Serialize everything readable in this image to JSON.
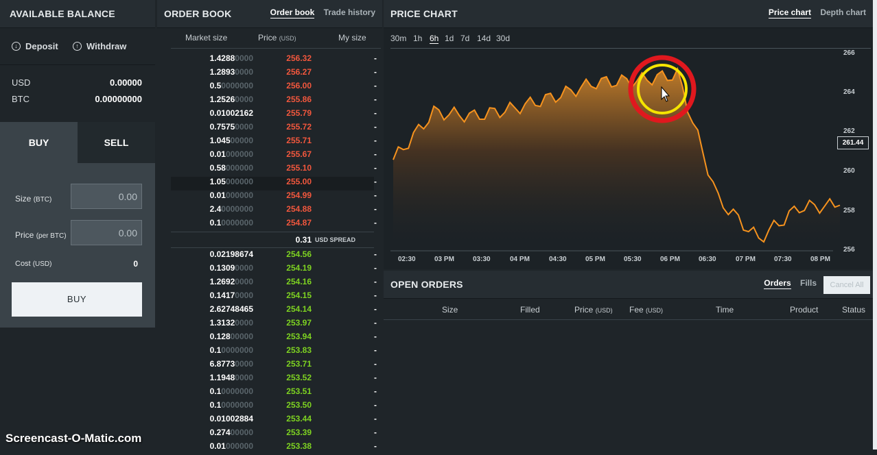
{
  "balance": {
    "title": "AVAILABLE BALANCE",
    "deposit": "Deposit",
    "withdraw": "Withdraw",
    "rows": [
      {
        "cur": "USD",
        "val": "0.00000"
      },
      {
        "cur": "BTC",
        "val": "0.00000000"
      }
    ]
  },
  "trade": {
    "buy_tab": "BUY",
    "sell_tab": "SELL",
    "size_label": "Size",
    "size_unit": "(BTC)",
    "size_value": "0.00",
    "price_label": "Price",
    "price_unit": "(per BTC)",
    "price_value": "0.00",
    "cost_label": "Cost",
    "cost_unit": "(USD)",
    "cost_value": "0",
    "buy_button": "BUY"
  },
  "book": {
    "title": "ORDER BOOK",
    "tab_active": "Order book",
    "tab_other": "Trade history",
    "col_size": "Market size",
    "col_price": "Price",
    "col_price_unit": "(USD)",
    "col_my": "My size",
    "asks": [
      {
        "sz": "1.4288",
        "dim": "0000",
        "pr": "256.32",
        "my": "-"
      },
      {
        "sz": "1.2893",
        "dim": "0000",
        "pr": "256.27",
        "my": "-"
      },
      {
        "sz": "0.5",
        "dim": "0000000",
        "pr": "256.00",
        "my": "-"
      },
      {
        "sz": "1.2526",
        "dim": "0000",
        "pr": "255.86",
        "my": "-"
      },
      {
        "sz": "0.01002162",
        "dim": "",
        "pr": "255.79",
        "my": "-"
      },
      {
        "sz": "0.7575",
        "dim": "0000",
        "pr": "255.72",
        "my": "-"
      },
      {
        "sz": "1.045",
        "dim": "00000",
        "pr": "255.71",
        "my": "-"
      },
      {
        "sz": "0.01",
        "dim": "000000",
        "pr": "255.67",
        "my": "-"
      },
      {
        "sz": "0.58",
        "dim": "000000",
        "pr": "255.10",
        "my": "-"
      },
      {
        "sz": "1.05",
        "dim": "000000",
        "pr": "255.00",
        "my": "-"
      },
      {
        "sz": "0.01",
        "dim": "000000",
        "pr": "254.99",
        "my": "-"
      },
      {
        "sz": "2.4",
        "dim": "0000000",
        "pr": "254.88",
        "my": "-"
      },
      {
        "sz": "0.1",
        "dim": "0000000",
        "pr": "254.87",
        "my": "-"
      }
    ],
    "spread_value": "0.31",
    "spread_label": "USD SPREAD",
    "bids": [
      {
        "sz": "0.02198674",
        "dim": "",
        "pr": "254.56",
        "my": "-"
      },
      {
        "sz": "0.1309",
        "dim": "0000",
        "pr": "254.19",
        "my": "-"
      },
      {
        "sz": "1.2692",
        "dim": "0000",
        "pr": "254.16",
        "my": "-"
      },
      {
        "sz": "0.1417",
        "dim": "0000",
        "pr": "254.15",
        "my": "-"
      },
      {
        "sz": "2.62748465",
        "dim": "",
        "pr": "254.14",
        "my": "-"
      },
      {
        "sz": "1.3132",
        "dim": "0000",
        "pr": "253.97",
        "my": "-"
      },
      {
        "sz": "0.128",
        "dim": "00000",
        "pr": "253.94",
        "my": "-"
      },
      {
        "sz": "0.1",
        "dim": "0000000",
        "pr": "253.83",
        "my": "-"
      },
      {
        "sz": "6.8773",
        "dim": "0000",
        "pr": "253.71",
        "my": "-"
      },
      {
        "sz": "1.1948",
        "dim": "0000",
        "pr": "253.52",
        "my": "-"
      },
      {
        "sz": "0.1",
        "dim": "0000000",
        "pr": "253.51",
        "my": "-"
      },
      {
        "sz": "0.1",
        "dim": "0000000",
        "pr": "253.50",
        "my": "-"
      },
      {
        "sz": "0.01002884",
        "dim": "",
        "pr": "253.44",
        "my": "-"
      },
      {
        "sz": "0.274",
        "dim": "00000",
        "pr": "253.39",
        "my": "-"
      },
      {
        "sz": "0.01",
        "dim": "000000",
        "pr": "253.38",
        "my": "-"
      }
    ]
  },
  "chart": {
    "title": "PRICE CHART",
    "tab_active": "Price chart",
    "tab_other": "Depth chart",
    "timeframes": [
      "30m",
      "1h",
      "6h",
      "1d",
      "7d",
      "14d",
      "30d"
    ],
    "active_timeframe": "6h",
    "y_ticks": [
      "266",
      "264",
      "262",
      "260",
      "258",
      "256"
    ],
    "x_ticks": [
      "02:30",
      "03 PM",
      "03:30",
      "04 PM",
      "04:30",
      "05 PM",
      "05:30",
      "06 PM",
      "06:30",
      "07 PM",
      "07:30",
      "08 PM"
    ],
    "current_price": "261.44",
    "line_color": "#f7931e"
  },
  "chart_data": {
    "type": "area",
    "x": [
      "02:30",
      "03 PM",
      "03:30",
      "04 PM",
      "04:30",
      "05 PM",
      "05:30",
      "06 PM",
      "06:30",
      "07 PM",
      "07:30",
      "08 PM"
    ],
    "values": [
      260.6,
      263.0,
      262.8,
      263.2,
      263.8,
      264.5,
      264.6,
      264.9,
      258.6,
      256.6,
      258.2,
      258.3
    ],
    "ylim": [
      256,
      266
    ],
    "xlabel": "",
    "ylabel": ""
  },
  "orders": {
    "title": "OPEN ORDERS",
    "tab_active": "Orders",
    "tab_other": "Fills",
    "cancel_all": "Cancel All",
    "cols": [
      "Size",
      "Filled",
      "Price",
      "Fee",
      "Time",
      "Product",
      "Status"
    ],
    "price_unit": "(USD)",
    "fee_unit": "(USD)"
  },
  "watermark": "Screencast-O-Matic.com"
}
